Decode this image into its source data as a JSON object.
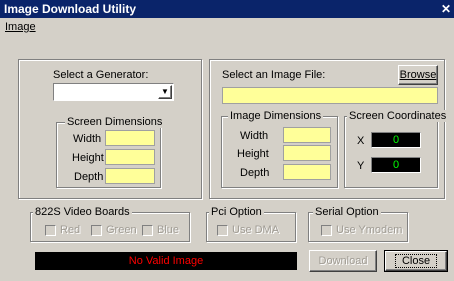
{
  "window": {
    "title": "Image Download Utility",
    "close_glyph": "✕"
  },
  "menu": {
    "items": [
      {
        "label": "Image"
      }
    ]
  },
  "generator": {
    "label": "Select a Generator:",
    "selected": "",
    "dimensions": {
      "legend": "Screen Dimensions",
      "width_label": "Width",
      "height_label": "Height",
      "depth_label": "Depth",
      "width_value": "",
      "height_value": "",
      "depth_value": ""
    }
  },
  "image_file": {
    "label": "Select an Image File:",
    "browse_label": "Browse",
    "path_value": "",
    "dimensions": {
      "legend": "Image Dimensions",
      "width_label": "Width",
      "height_label": "Height",
      "depth_label": "Depth",
      "width_value": "",
      "height_value": "",
      "depth_value": ""
    },
    "coordinates": {
      "legend": "Screen Coordinates",
      "x_label": "X",
      "y_label": "Y",
      "x_value": "0",
      "y_value": "0"
    }
  },
  "video_boards": {
    "legend": "822S Video Boards",
    "options": [
      {
        "label": "Red"
      },
      {
        "label": "Green"
      },
      {
        "label": "Blue"
      }
    ]
  },
  "pci_option": {
    "legend": "Pci Option",
    "option_label": "Use DMA"
  },
  "serial_option": {
    "legend": "Serial Option",
    "option_label": "Use Ymodem"
  },
  "status": {
    "message": "No Valid Image"
  },
  "actions": {
    "download_label": "Download",
    "close_label": "Close"
  },
  "colors": {
    "title_bar": "#0a246a",
    "field_yellow": "#ffff99",
    "readout_green": "#00ff00",
    "status_red": "#ff0000",
    "face": "#d4d0c8"
  },
  "icons": {
    "combo_arrow": "triangle-down",
    "title_close": "close-x"
  }
}
